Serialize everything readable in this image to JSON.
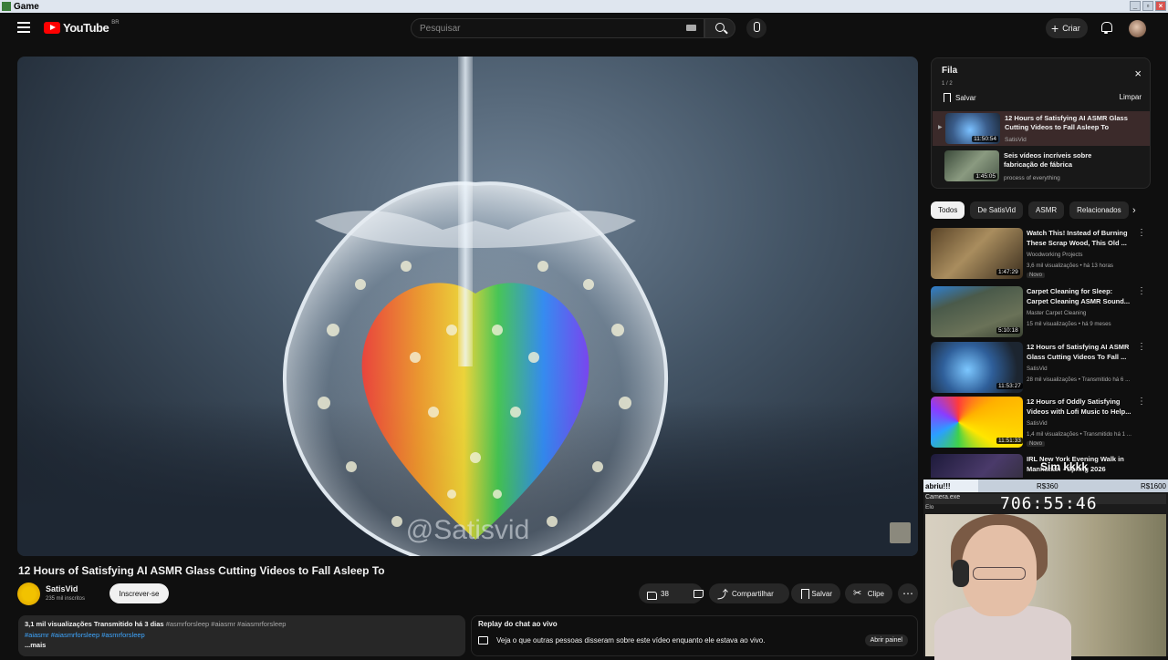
{
  "window": {
    "title": "Game",
    "controls": [
      "_",
      "▫",
      "×"
    ]
  },
  "header": {
    "logo_text": "YouTube",
    "logo_country": "BR",
    "search_placeholder": "Pesquisar",
    "create_label": "Criar"
  },
  "video": {
    "watermark": "@Satisvid",
    "title": "12 Hours of Satisfying AI ASMR Glass Cutting Videos to Fall Asleep To",
    "channel": "SatisVid",
    "subscribers": "235 mil inscritos",
    "subscribe_label": "Inscrever-se",
    "likes": "38",
    "share_label": "Compartilhar",
    "save_label": "Salvar",
    "clip_label": "Clipe",
    "more_label": "⋯"
  },
  "description": {
    "views": "3,1 mil visualizações",
    "streamed": "Transmitido há 3 dias",
    "tags_line1": "#asmrforsleep #aiasmr #aiasmrforsleep",
    "tags_line2": "#aiasmr #aiasmrforsleep #asmrforsleep",
    "more": "...mais"
  },
  "chat_replay": {
    "title": "Replay do chat ao vivo",
    "text": "Veja o que outras pessoas disseram sobre este vídeo enquanto ele estava ao vivo.",
    "button": "Abrir painel"
  },
  "queue": {
    "title": "Fila",
    "count": "1 / 2",
    "save": "Salvar",
    "clear": "Limpar",
    "close": "×",
    "items": [
      {
        "title_l1": "12 Hours of Satisfying AI ASMR Glass",
        "title_l2": "Cutting Videos to Fall Asleep To",
        "channel": "SatisVid",
        "duration": "11:50:54"
      },
      {
        "title_l1": "Seis vídeos incríveis sobre",
        "title_l2": "fabricação de fábrica",
        "channel": "process of everything",
        "duration": "1:45:05"
      }
    ]
  },
  "chips": [
    "Todos",
    "De SatisVid",
    "ASMR",
    "Relacionados"
  ],
  "recommendations": [
    {
      "title_l1": "Watch This! Instead of Burning",
      "title_l2": "These Scrap Wood, This Old ...",
      "channel": "Woodworking Projects",
      "meta": "3,6 mil visualizações • há 13 horas",
      "badge": "Novo",
      "duration": "1:47:29"
    },
    {
      "title_l1": "Carpet Cleaning for Sleep:",
      "title_l2": "Carpet Cleaning ASMR Sound...",
      "channel": "Master Carpet Cleaning",
      "meta": "15 mil visualizações • há 9 meses",
      "badge": "",
      "duration": "5:10:18"
    },
    {
      "title_l1": "12 Hours of Satisfying AI ASMR",
      "title_l2": "Glass Cutting Videos To Fall ...",
      "channel": "SatisVid",
      "meta": "28 mil visualizações • Transmitido há 6 ...",
      "badge": "",
      "duration": "11:53:27"
    },
    {
      "title_l1": "12 Hours of Oddly Satisfying",
      "title_l2": "Videos with Lofi Music to Help...",
      "channel": "SatisVid",
      "meta": "1,4 mil visualizações • Transmitido há 1 ...",
      "badge": "Novo",
      "duration": "11:51:33"
    },
    {
      "title_l1": "IRL New York Evening Walk in",
      "title_l2": "Manhattan - Spring 2026",
      "channel": "",
      "meta": "",
      "badge": "",
      "duration": ""
    }
  ],
  "overlay": {
    "caption": "Sim kkkk",
    "progress_label": "abriu!!!",
    "goal_mid": "R$360",
    "goal_end": "R$1600",
    "camera_label": "Camera.exe",
    "camera_sub": "Elo",
    "timer": "706:55:46"
  }
}
